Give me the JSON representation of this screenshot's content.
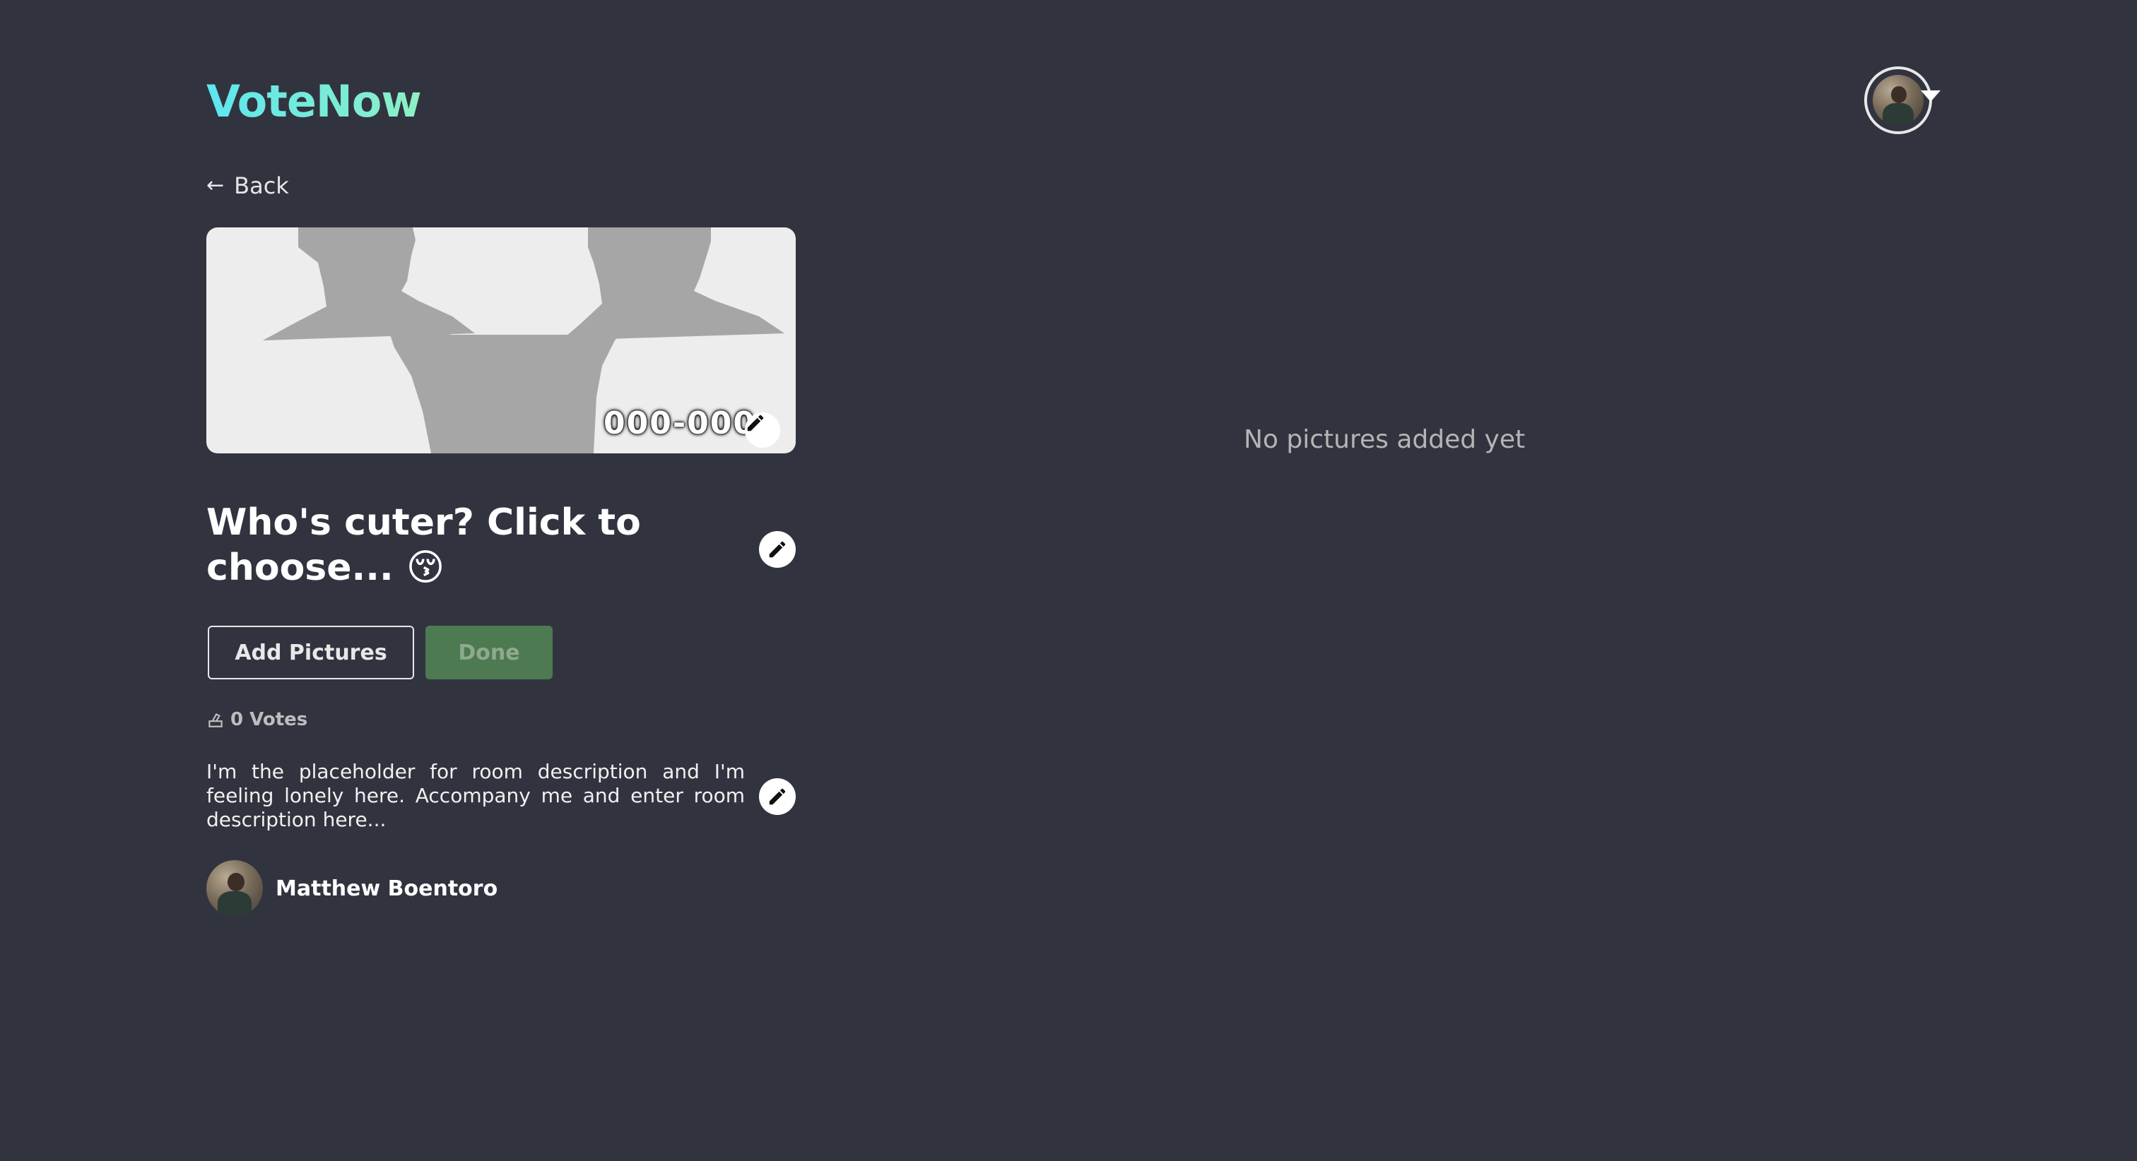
{
  "app": {
    "logo_text": "VoteNow",
    "logo_gradient": [
      "#5ee6f0",
      "#8ef0c4"
    ]
  },
  "header": {
    "user_avatar": "user-avatar-photo",
    "menu_icon": "caret-down-icon"
  },
  "nav": {
    "back_label": "Back",
    "back_icon": "arrow-left-icon"
  },
  "room": {
    "banner_image": "silhouette-placeholder",
    "code": "000-000",
    "title": "Who's cuter? Click to choose... 😚",
    "votes_label": "0 Votes",
    "votes_icon": "ballot-icon",
    "description": "I'm the placeholder for room description and I'm feeling lonely here. Accompany me and enter room description here...",
    "owner_name": "Matthew Boentoro"
  },
  "actions": {
    "add_pictures_label": "Add Pictures",
    "done_label": "Done"
  },
  "pictures": {
    "empty_message": "No pictures added yet"
  },
  "colors": {
    "background": "#31343f",
    "done_button": "#4d7a50",
    "banner_bg": "#ededed",
    "silhouette": "#a6a6a6"
  }
}
